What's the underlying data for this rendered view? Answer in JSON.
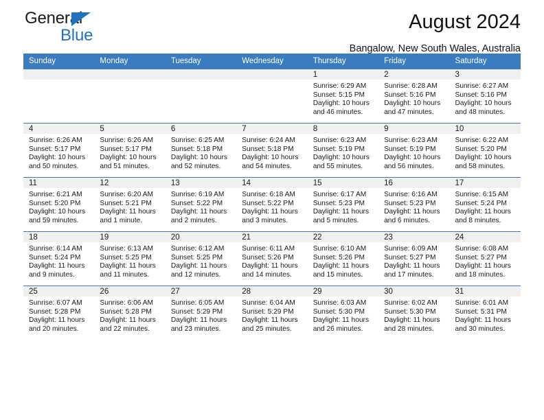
{
  "branding": {
    "logo_top": "General",
    "logo_bottom": "Blue",
    "accent_color": "#1f72bd",
    "header_color": "#3a7cbf",
    "band_color": "#f0f0f0"
  },
  "header": {
    "title": "August 2024",
    "subtitle": "Bangalow, New South Wales, Australia"
  },
  "calendar": {
    "weekday_headers": [
      "Sunday",
      "Monday",
      "Tuesday",
      "Wednesday",
      "Thursday",
      "Friday",
      "Saturday"
    ],
    "weeks": [
      [
        {
          "day": "",
          "blank": true,
          "sunrise": "",
          "sunset": "",
          "daylight": ""
        },
        {
          "day": "",
          "blank": true,
          "sunrise": "",
          "sunset": "",
          "daylight": ""
        },
        {
          "day": "",
          "blank": true,
          "sunrise": "",
          "sunset": "",
          "daylight": ""
        },
        {
          "day": "",
          "blank": true,
          "sunrise": "",
          "sunset": "",
          "daylight": ""
        },
        {
          "day": "1",
          "blank": false,
          "sunrise": "Sunrise: 6:29 AM",
          "sunset": "Sunset: 5:15 PM",
          "daylight": "Daylight: 10 hours and 46 minutes."
        },
        {
          "day": "2",
          "blank": false,
          "sunrise": "Sunrise: 6:28 AM",
          "sunset": "Sunset: 5:16 PM",
          "daylight": "Daylight: 10 hours and 47 minutes."
        },
        {
          "day": "3",
          "blank": false,
          "sunrise": "Sunrise: 6:27 AM",
          "sunset": "Sunset: 5:16 PM",
          "daylight": "Daylight: 10 hours and 48 minutes."
        }
      ],
      [
        {
          "day": "4",
          "blank": false,
          "sunrise": "Sunrise: 6:26 AM",
          "sunset": "Sunset: 5:17 PM",
          "daylight": "Daylight: 10 hours and 50 minutes."
        },
        {
          "day": "5",
          "blank": false,
          "sunrise": "Sunrise: 6:26 AM",
          "sunset": "Sunset: 5:17 PM",
          "daylight": "Daylight: 10 hours and 51 minutes."
        },
        {
          "day": "6",
          "blank": false,
          "sunrise": "Sunrise: 6:25 AM",
          "sunset": "Sunset: 5:18 PM",
          "daylight": "Daylight: 10 hours and 52 minutes."
        },
        {
          "day": "7",
          "blank": false,
          "sunrise": "Sunrise: 6:24 AM",
          "sunset": "Sunset: 5:18 PM",
          "daylight": "Daylight: 10 hours and 54 minutes."
        },
        {
          "day": "8",
          "blank": false,
          "sunrise": "Sunrise: 6:23 AM",
          "sunset": "Sunset: 5:19 PM",
          "daylight": "Daylight: 10 hours and 55 minutes."
        },
        {
          "day": "9",
          "blank": false,
          "sunrise": "Sunrise: 6:23 AM",
          "sunset": "Sunset: 5:19 PM",
          "daylight": "Daylight: 10 hours and 56 minutes."
        },
        {
          "day": "10",
          "blank": false,
          "sunrise": "Sunrise: 6:22 AM",
          "sunset": "Sunset: 5:20 PM",
          "daylight": "Daylight: 10 hours and 58 minutes."
        }
      ],
      [
        {
          "day": "11",
          "blank": false,
          "sunrise": "Sunrise: 6:21 AM",
          "sunset": "Sunset: 5:20 PM",
          "daylight": "Daylight: 10 hours and 59 minutes."
        },
        {
          "day": "12",
          "blank": false,
          "sunrise": "Sunrise: 6:20 AM",
          "sunset": "Sunset: 5:21 PM",
          "daylight": "Daylight: 11 hours and 1 minute."
        },
        {
          "day": "13",
          "blank": false,
          "sunrise": "Sunrise: 6:19 AM",
          "sunset": "Sunset: 5:22 PM",
          "daylight": "Daylight: 11 hours and 2 minutes."
        },
        {
          "day": "14",
          "blank": false,
          "sunrise": "Sunrise: 6:18 AM",
          "sunset": "Sunset: 5:22 PM",
          "daylight": "Daylight: 11 hours and 3 minutes."
        },
        {
          "day": "15",
          "blank": false,
          "sunrise": "Sunrise: 6:17 AM",
          "sunset": "Sunset: 5:23 PM",
          "daylight": "Daylight: 11 hours and 5 minutes."
        },
        {
          "day": "16",
          "blank": false,
          "sunrise": "Sunrise: 6:16 AM",
          "sunset": "Sunset: 5:23 PM",
          "daylight": "Daylight: 11 hours and 6 minutes."
        },
        {
          "day": "17",
          "blank": false,
          "sunrise": "Sunrise: 6:15 AM",
          "sunset": "Sunset: 5:24 PM",
          "daylight": "Daylight: 11 hours and 8 minutes."
        }
      ],
      [
        {
          "day": "18",
          "blank": false,
          "sunrise": "Sunrise: 6:14 AM",
          "sunset": "Sunset: 5:24 PM",
          "daylight": "Daylight: 11 hours and 9 minutes."
        },
        {
          "day": "19",
          "blank": false,
          "sunrise": "Sunrise: 6:13 AM",
          "sunset": "Sunset: 5:25 PM",
          "daylight": "Daylight: 11 hours and 11 minutes."
        },
        {
          "day": "20",
          "blank": false,
          "sunrise": "Sunrise: 6:12 AM",
          "sunset": "Sunset: 5:25 PM",
          "daylight": "Daylight: 11 hours and 12 minutes."
        },
        {
          "day": "21",
          "blank": false,
          "sunrise": "Sunrise: 6:11 AM",
          "sunset": "Sunset: 5:26 PM",
          "daylight": "Daylight: 11 hours and 14 minutes."
        },
        {
          "day": "22",
          "blank": false,
          "sunrise": "Sunrise: 6:10 AM",
          "sunset": "Sunset: 5:26 PM",
          "daylight": "Daylight: 11 hours and 15 minutes."
        },
        {
          "day": "23",
          "blank": false,
          "sunrise": "Sunrise: 6:09 AM",
          "sunset": "Sunset: 5:27 PM",
          "daylight": "Daylight: 11 hours and 17 minutes."
        },
        {
          "day": "24",
          "blank": false,
          "sunrise": "Sunrise: 6:08 AM",
          "sunset": "Sunset: 5:27 PM",
          "daylight": "Daylight: 11 hours and 18 minutes."
        }
      ],
      [
        {
          "day": "25",
          "blank": false,
          "sunrise": "Sunrise: 6:07 AM",
          "sunset": "Sunset: 5:28 PM",
          "daylight": "Daylight: 11 hours and 20 minutes."
        },
        {
          "day": "26",
          "blank": false,
          "sunrise": "Sunrise: 6:06 AM",
          "sunset": "Sunset: 5:28 PM",
          "daylight": "Daylight: 11 hours and 22 minutes."
        },
        {
          "day": "27",
          "blank": false,
          "sunrise": "Sunrise: 6:05 AM",
          "sunset": "Sunset: 5:29 PM",
          "daylight": "Daylight: 11 hours and 23 minutes."
        },
        {
          "day": "28",
          "blank": false,
          "sunrise": "Sunrise: 6:04 AM",
          "sunset": "Sunset: 5:29 PM",
          "daylight": "Daylight: 11 hours and 25 minutes."
        },
        {
          "day": "29",
          "blank": false,
          "sunrise": "Sunrise: 6:03 AM",
          "sunset": "Sunset: 5:30 PM",
          "daylight": "Daylight: 11 hours and 26 minutes."
        },
        {
          "day": "30",
          "blank": false,
          "sunrise": "Sunrise: 6:02 AM",
          "sunset": "Sunset: 5:30 PM",
          "daylight": "Daylight: 11 hours and 28 minutes."
        },
        {
          "day": "31",
          "blank": false,
          "sunrise": "Sunrise: 6:01 AM",
          "sunset": "Sunset: 5:31 PM",
          "daylight": "Daylight: 11 hours and 30 minutes."
        }
      ]
    ]
  }
}
